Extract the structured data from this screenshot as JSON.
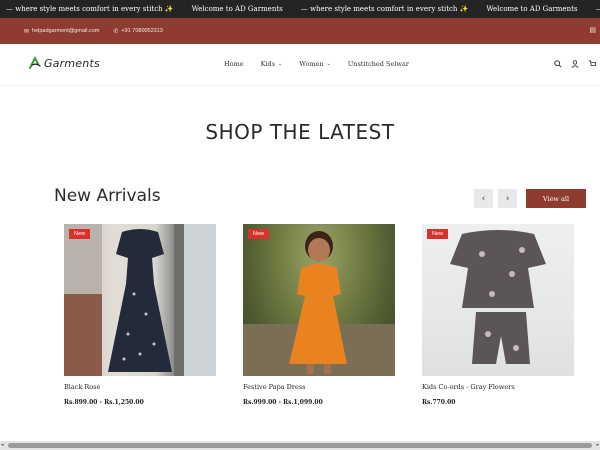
{
  "marquee": {
    "items": [
      "— where style meets comfort in every stitch ✨",
      "Welcome to AD Garments",
      "— where style meets comfort in every stitch ✨",
      "Welcome to AD Garments",
      "— where style meets comfort in every stitch ✨"
    ]
  },
  "contact": {
    "email": "helpadgarment@gmail.com",
    "phone": "+91 7080052313",
    "email_icon": "mail-icon",
    "phone_icon": "phone-icon"
  },
  "header": {
    "logo_mark": "AD",
    "logo_word": "Garments",
    "nav": [
      {
        "label": "Home",
        "has_dropdown": false
      },
      {
        "label": "Kids",
        "has_dropdown": true
      },
      {
        "label": "Women",
        "has_dropdown": true
      },
      {
        "label": "Unstitched Selwar",
        "has_dropdown": false
      }
    ],
    "icons": [
      "search-icon",
      "user-icon",
      "cart-icon"
    ]
  },
  "main": {
    "shop_title": "SHOP THE LATEST",
    "section_title": "New Arrivals",
    "view_all_label": "View all",
    "prev_glyph": "‹",
    "next_glyph": "›",
    "products": [
      {
        "badge": "New",
        "name": "Black Rose",
        "price": "Rs.899.00 - Rs.1,250.00"
      },
      {
        "badge": "New",
        "name": "Festive Papa Dress",
        "price": "Rs.999.00 - Rs.1,099.00"
      },
      {
        "badge": "New",
        "name": "Kids Co-ords - Gray Flowers",
        "price": "Rs.770.00"
      }
    ]
  },
  "colors": {
    "marquee_bg": "#242424",
    "contact_bg": "#8e3c30",
    "accent": "#8e3c30",
    "badge": "#d8312b",
    "logo_green": "#3d9a3a"
  }
}
